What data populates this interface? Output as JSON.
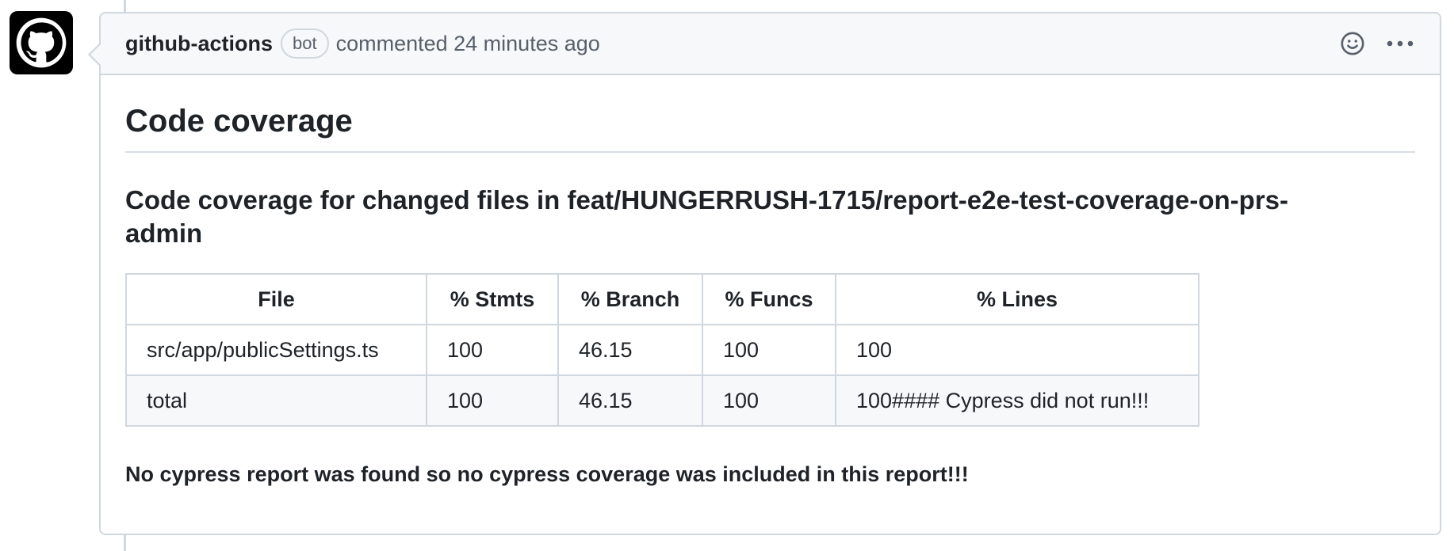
{
  "comment": {
    "author": "github-actions",
    "badge": "bot",
    "meta": "commented 24 minutes ago",
    "icons": {
      "avatar": "github-octocat-icon",
      "reaction": "smiley-icon",
      "menu": "kebab-horizontal-icon"
    }
  },
  "body": {
    "heading": "Code coverage",
    "subheading": "Code coverage for changed files in feat/HUNGERRUSH-1715/report-e2e-test-coverage-on-prs-admin",
    "table": {
      "headers": [
        "File",
        "% Stmts",
        "% Branch",
        "% Funcs",
        "% Lines"
      ],
      "rows": [
        [
          "src/app/publicSettings.ts",
          "100",
          "46.15",
          "100",
          "100"
        ],
        [
          "total",
          "100",
          "46.15",
          "100",
          "100#### Cypress did not run!!!"
        ]
      ]
    },
    "note": "No cypress report was found so no cypress coverage was included in this report!!!"
  },
  "colors": {
    "border": "#d0d7de",
    "header_bg": "#f6f8fa",
    "text": "#1f2328",
    "muted": "#57606a"
  }
}
